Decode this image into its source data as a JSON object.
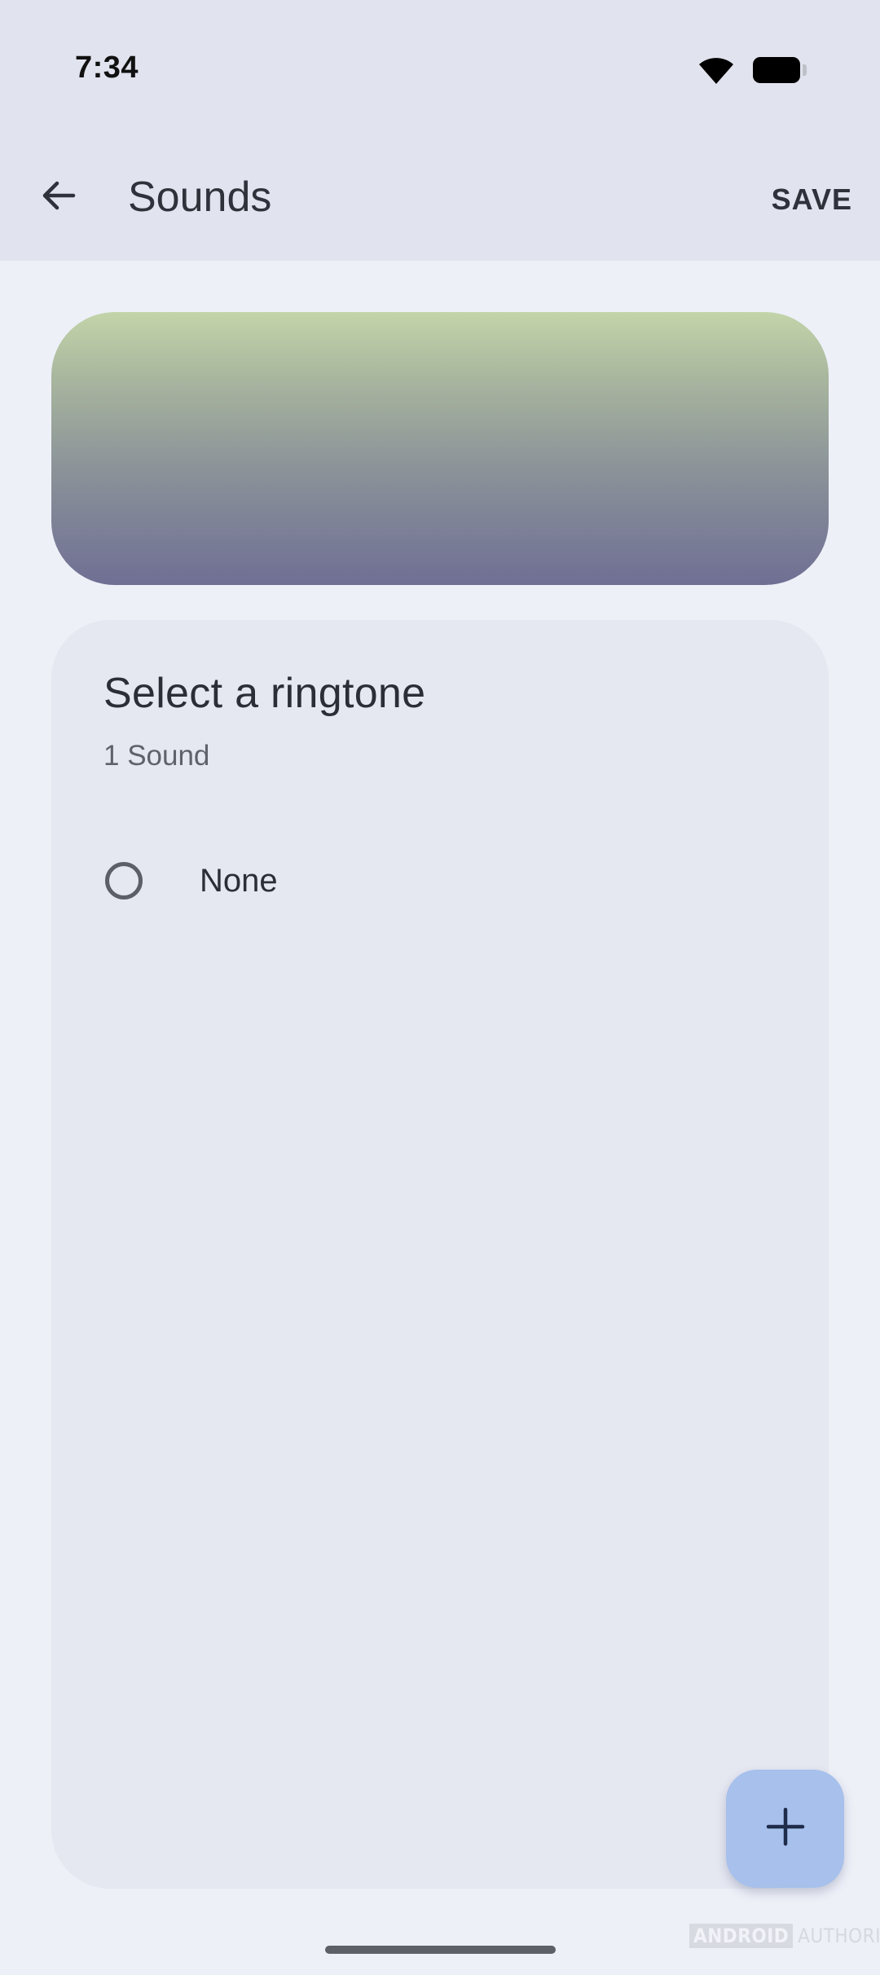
{
  "status_bar": {
    "time": "7:34",
    "icons": [
      "wifi-icon",
      "battery-icon"
    ]
  },
  "app_bar": {
    "back_icon": "arrow-left-icon",
    "title": "Sounds",
    "save_label": "SAVE"
  },
  "ringtone_card": {
    "title": "Select a ringtone",
    "subtitle": "1 Sound",
    "options": [
      {
        "label": "None",
        "selected": false
      }
    ]
  },
  "fab": {
    "icon": "plus-icon"
  },
  "watermark": {
    "part1": "ANDROID",
    "part2": "AUTHORITY"
  },
  "colors": {
    "background": "#eef0f8",
    "top_bar": "#e1e3ee",
    "card": "#e5e7f1",
    "fab": "#a7c0ec",
    "banner_top": "#c3d4a9",
    "banner_bottom": "#6f6f94"
  }
}
